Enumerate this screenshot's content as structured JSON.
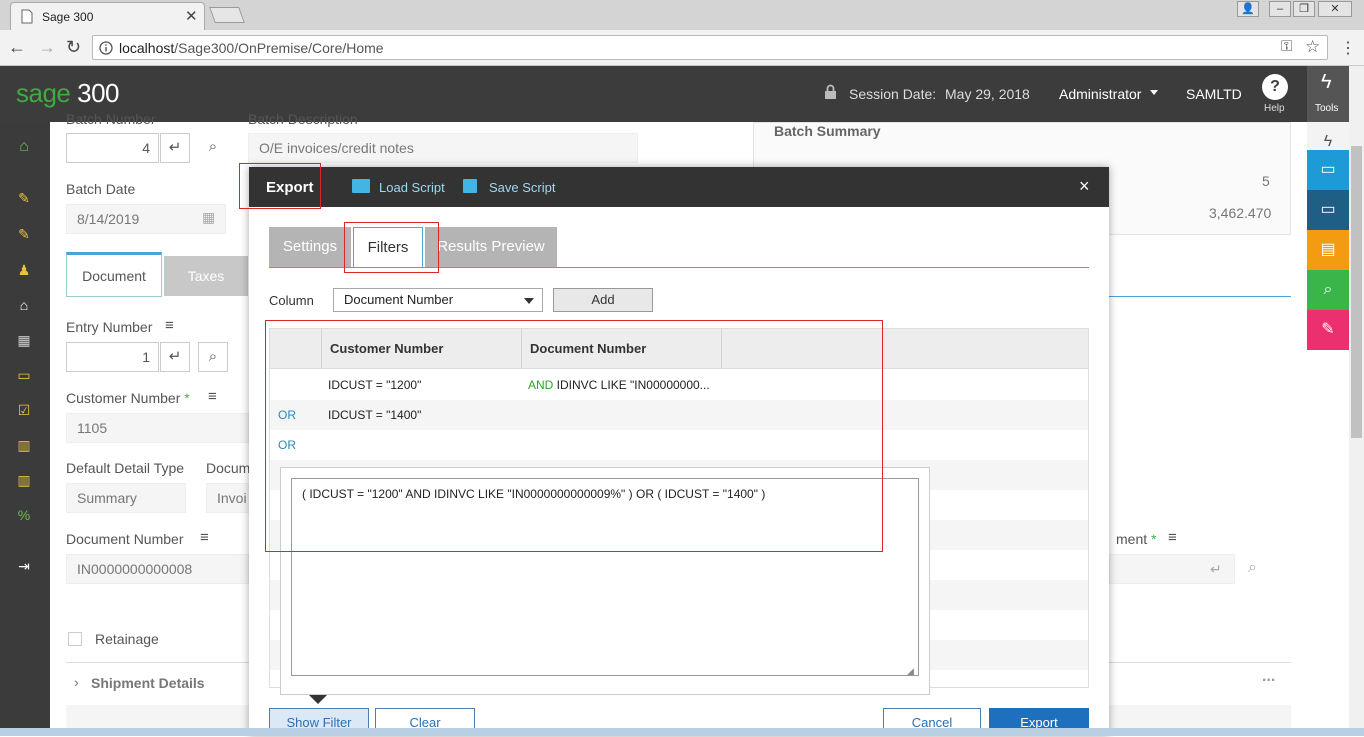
{
  "browser": {
    "tab_title": "Sage 300",
    "url_host": "localhost",
    "url_path": "/Sage300/OnPremise/Core/Home"
  },
  "header": {
    "logo_brand": "sage",
    "logo_num": "300",
    "session_label": "Session Date:",
    "session_date": "May 29, 2018",
    "user": "Administrator",
    "company": "SAMLTD",
    "help_label": "Help",
    "tools_label": "Tools"
  },
  "form": {
    "batch_number_label": "Batch Number",
    "batch_number": "4",
    "batch_desc_label": "Batch Description",
    "batch_desc": "O/E invoices/credit notes",
    "batch_summary": "Batch Summary",
    "summary_val1": "5",
    "summary_val2": "3,462.470",
    "batch_date_label": "Batch Date",
    "batch_date": "8/14/2019",
    "tab_document": "Document",
    "tab_taxes": "Taxes",
    "entry_number_label": "Entry Number",
    "entry_number": "1",
    "customer_number_label": "Customer Number",
    "required_mark": "*",
    "customer_number": "1105",
    "detail_type_label": "Default Detail Type",
    "detail_type_value": "Summary",
    "docum_label": "Docum",
    "invoi_value": "Invoi",
    "document_number_label": "Document Number",
    "document_number": "IN0000000000008",
    "adjustment_label": "ment",
    "retainage_label": "Retainage",
    "shipment_details": "Shipment Details",
    "more_dots": "..."
  },
  "modal": {
    "title": "Export",
    "load_script": "Load Script",
    "save_script": "Save Script",
    "close": "×",
    "tabs": [
      {
        "label": "Settings"
      },
      {
        "label": "Filters"
      },
      {
        "label": "Results Preview"
      }
    ],
    "column_label": "Column",
    "column_value": "Document Number",
    "add_button": "Add",
    "grid_headers": [
      "",
      "Customer Number",
      "Document Number",
      ""
    ],
    "rows": [
      {
        "op": "",
        "customer": "IDCUST = \"1200\"",
        "doc_kw": "AND",
        "doc": " IDINVC LIKE \"IN00000000..."
      },
      {
        "op": "OR",
        "customer": "IDCUST = \"1400\"",
        "doc_kw": "",
        "doc": ""
      },
      {
        "op": "OR",
        "customer": "",
        "doc_kw": "",
        "doc": ""
      }
    ],
    "filter_expression": "( IDCUST = \"1200\" AND IDINVC LIKE \"IN0000000000009%\" ) OR ( IDCUST = \"1400\" )",
    "show_filter": "Show Filter",
    "clear": "Clear",
    "cancel": "Cancel",
    "export": "Export"
  },
  "colors": {
    "sage_green": "#41a940",
    "header_dark": "#3c3c3c",
    "primary_blue": "#1f6fbf",
    "highlight_red": "#d9262b"
  }
}
